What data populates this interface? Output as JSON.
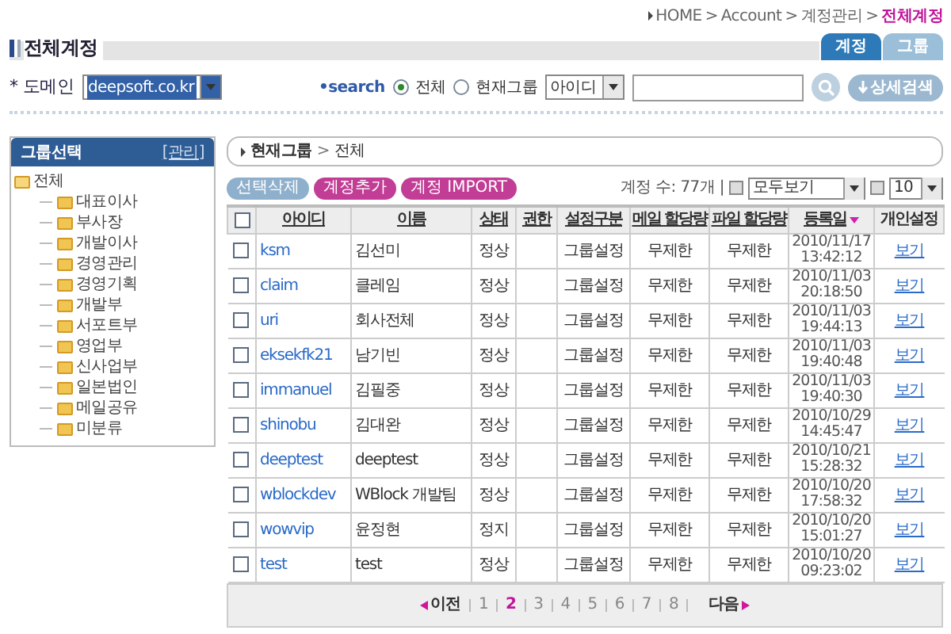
{
  "breadcrumb": {
    "items": [
      "HOME",
      "Account",
      "계정관리",
      "전체계정"
    ],
    "separator": ">"
  },
  "page_title": "전체계정",
  "tabs": [
    {
      "label": "계정",
      "selected": true
    },
    {
      "label": "그룹",
      "selected": false
    }
  ],
  "domain": {
    "label": "* 도메인",
    "value": "deepsoft.co.kr"
  },
  "search": {
    "label": "•search",
    "scopes": [
      {
        "label": "전체",
        "selected": true
      },
      {
        "label": "현재그룹",
        "selected": false
      }
    ],
    "field_select": "아이디",
    "detail_button": "상세검색"
  },
  "sidebar": {
    "title": "그룹선택",
    "manage": "[관리]",
    "tree": [
      {
        "label": "전체",
        "expanded": true,
        "children": [
          {
            "label": "대표이사"
          },
          {
            "label": "부사장"
          },
          {
            "label": "개발이사"
          },
          {
            "label": "경영관리"
          },
          {
            "label": "경영기획"
          },
          {
            "label": "개발부"
          },
          {
            "label": "서포트부"
          },
          {
            "label": "영업부"
          },
          {
            "label": "신사업부"
          },
          {
            "label": "일본법인"
          },
          {
            "label": "메일공유"
          },
          {
            "label": "미분류"
          }
        ]
      }
    ]
  },
  "path": {
    "items": [
      "현재그룹",
      "전체"
    ],
    "separator": ">"
  },
  "actions": [
    {
      "label": "선택삭제",
      "kind": "muted"
    },
    {
      "label": "계정추가",
      "kind": "accent"
    },
    {
      "label": "계정 IMPORT",
      "kind": "accent"
    }
  ],
  "count": "계정 수: 77개 |",
  "view_select": "모두보기",
  "page_size": "10",
  "table": {
    "header_checked": false,
    "columns": [
      {
        "label": "아이디",
        "sorted": false
      },
      {
        "label": "이름",
        "sorted": false
      },
      {
        "label": "상태",
        "sorted": false
      },
      {
        "label": "권한",
        "sorted": false
      },
      {
        "label": "설정구분",
        "sorted": false
      },
      {
        "label": "메일 할당량",
        "sorted": false
      },
      {
        "label": "파일 할당량",
        "sorted": false
      },
      {
        "label": "등록일",
        "sorted": true
      },
      {
        "label": "개인설정",
        "sorted": false
      }
    ],
    "rows": [
      {
        "checked": false,
        "id": "ksm",
        "name": "김선미",
        "status": "정상",
        "setting": "그룹설정",
        "mail_quota": "무제한",
        "file_quota": "무제한",
        "date": "2010/11/17",
        "time": "13:42:12",
        "link": "보기"
      },
      {
        "checked": false,
        "id": "claim",
        "name": "클레임",
        "status": "정상",
        "setting": "그룹설정",
        "mail_quota": "무제한",
        "file_quota": "무제한",
        "date": "2010/11/03",
        "time": "20:18:50",
        "link": "보기"
      },
      {
        "checked": false,
        "id": "uri",
        "name": "회사전체",
        "status": "정상",
        "setting": "그룹설정",
        "mail_quota": "무제한",
        "file_quota": "무제한",
        "date": "2010/11/03",
        "time": "19:44:13",
        "link": "보기"
      },
      {
        "checked": false,
        "id": "eksekfk21",
        "name": "남기빈",
        "status": "정상",
        "setting": "그룹설정",
        "mail_quota": "무제한",
        "file_quota": "무제한",
        "date": "2010/11/03",
        "time": "19:40:48",
        "link": "보기"
      },
      {
        "checked": false,
        "id": "immanuel",
        "name": "김필중",
        "status": "정상",
        "setting": "그룹설정",
        "mail_quota": "무제한",
        "file_quota": "무제한",
        "date": "2010/11/03",
        "time": "19:40:30",
        "link": "보기"
      },
      {
        "checked": false,
        "id": "shinobu",
        "name": "김대완",
        "status": "정상",
        "setting": "그룹설정",
        "mail_quota": "무제한",
        "file_quota": "무제한",
        "date": "2010/10/29",
        "time": "14:45:47",
        "link": "보기"
      },
      {
        "checked": false,
        "id": "deeptest",
        "name": "deeptest",
        "status": "정상",
        "setting": "그룹설정",
        "mail_quota": "무제한",
        "file_quota": "무제한",
        "date": "2010/10/21",
        "time": "15:28:32",
        "link": "보기"
      },
      {
        "checked": false,
        "id": "wblockdev",
        "name": "WBlock 개발팀",
        "status": "정상",
        "setting": "그룹설정",
        "mail_quota": "무제한",
        "file_quota": "무제한",
        "date": "2010/10/20",
        "time": "17:58:32",
        "link": "보기"
      },
      {
        "checked": false,
        "id": "wowvip",
        "name": "윤정현",
        "status": "정지",
        "setting": "그룹설정",
        "mail_quota": "무제한",
        "file_quota": "무제한",
        "date": "2010/10/20",
        "time": "15:01:27",
        "link": "보기"
      },
      {
        "checked": false,
        "id": "test",
        "name": "test",
        "status": "정상",
        "setting": "그룹설정",
        "mail_quota": "무제한",
        "file_quota": "무제한",
        "date": "2010/10/20",
        "time": "09:23:02",
        "link": "보기"
      }
    ]
  },
  "pagination": {
    "prev": "이전",
    "next": "다음",
    "pages": [
      {
        "label": "1",
        "selected": false
      },
      {
        "label": "2",
        "selected": true
      },
      {
        "label": "3",
        "selected": false
      },
      {
        "label": "4",
        "selected": false
      },
      {
        "label": "5",
        "selected": false
      },
      {
        "label": "6",
        "selected": false
      },
      {
        "label": "7",
        "selected": false
      },
      {
        "label": "8",
        "selected": false
      }
    ]
  }
}
